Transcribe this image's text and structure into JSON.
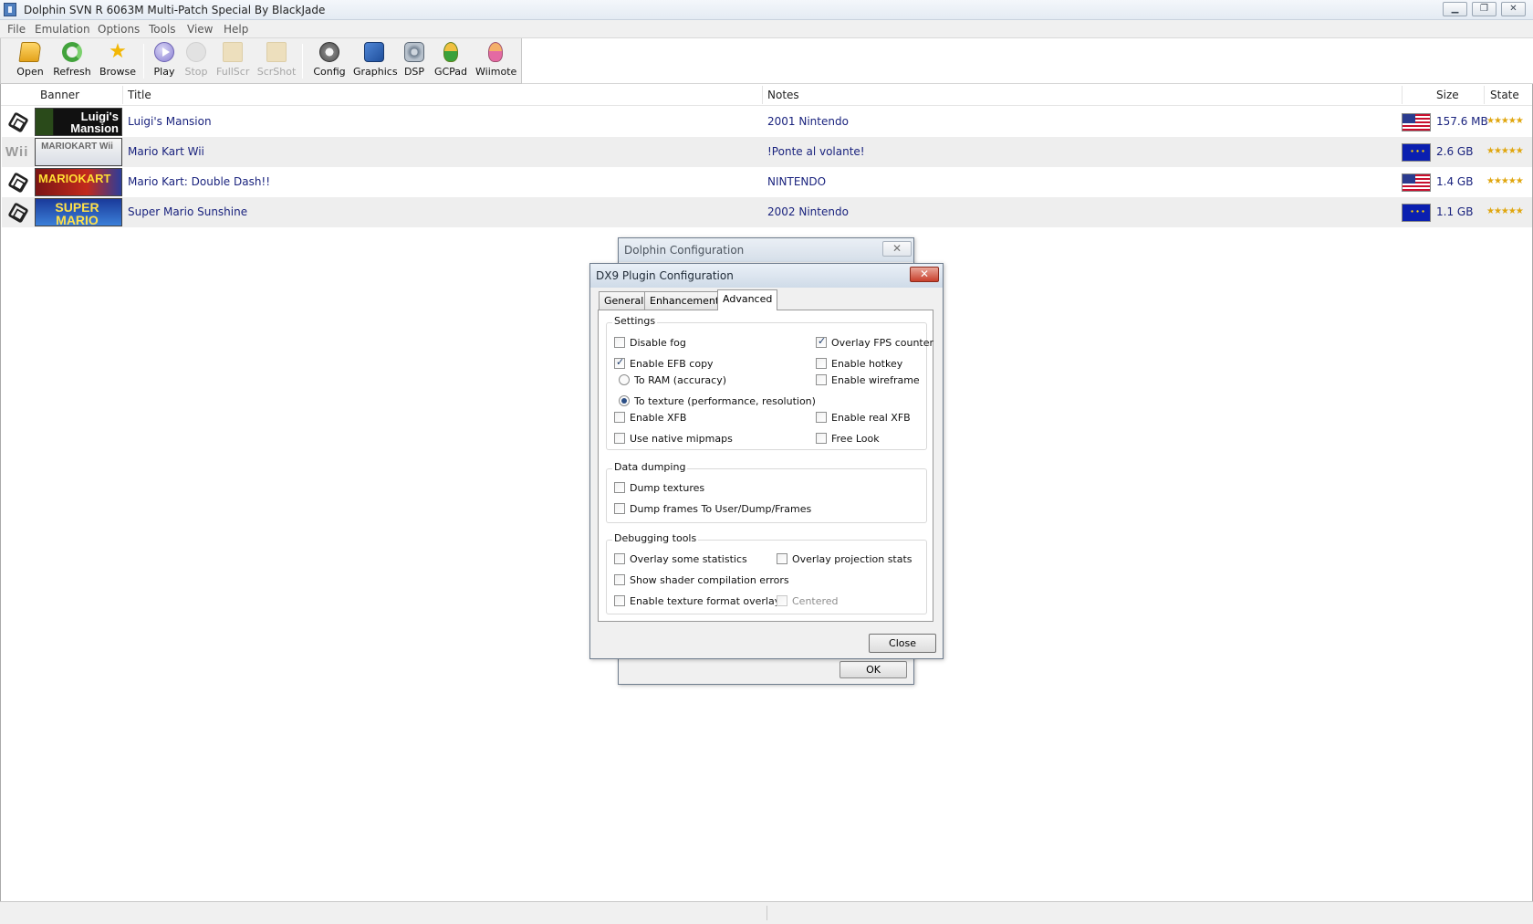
{
  "window": {
    "title": "Dolphin SVN R 6063M Multi-Patch Special By BlackJade",
    "minimize_icon": "minimize-icon",
    "maximize_icon": "restore-icon",
    "close_icon": "close-icon"
  },
  "menu": [
    "File",
    "Emulation",
    "Options",
    "Tools",
    "View",
    "Help"
  ],
  "toolbar": {
    "open": "Open",
    "refresh": "Refresh",
    "browse": "Browse",
    "play": "Play",
    "stop": "Stop",
    "fullscr": "FullScr",
    "scrshot": "ScrShot",
    "config": "Config",
    "graphics": "Graphics",
    "dsp": "DSP",
    "gcpad": "GCPad",
    "wiimote": "Wiimote",
    "disabled": [
      "Stop",
      "FullScr",
      "ScrShot"
    ]
  },
  "list": {
    "columns": {
      "banner": "Banner",
      "title": "Title",
      "notes": "Notes",
      "size": "Size",
      "state": "State"
    },
    "rows": [
      {
        "platform": "gamecube-icon",
        "banner": "Luigi's Mansion",
        "title": "Luigi's Mansion",
        "notes": "2001 Nintendo",
        "region": "usa-flag",
        "size": "157.6 MB",
        "state": "★★★★★"
      },
      {
        "platform": "Wii",
        "banner": "MARIOKART Wii",
        "title": "Mario Kart Wii",
        "notes": "!Ponte al volante!",
        "region": "eu-flag",
        "size": "2.6 GB",
        "state": "★★★★★"
      },
      {
        "platform": "gamecube-icon",
        "banner": "MARIOKART",
        "title": "Mario Kart: Double Dash!!",
        "notes": "NINTENDO",
        "region": "usa-flag",
        "size": "1.4 GB",
        "state": "★★★★★"
      },
      {
        "platform": "gamecube-icon",
        "banner": "SUPER MARIO SUNSHINE",
        "title": "Super Mario Sunshine",
        "notes": "2002  Nintendo",
        "region": "eu-flag",
        "size": "1.1 GB",
        "state": "★★★★★"
      }
    ]
  },
  "dolphin_config": {
    "title": "Dolphin Configuration",
    "ok": "OK"
  },
  "dx9_config": {
    "title": "DX9 Plugin Configuration",
    "tabs": [
      "General",
      "Enhancements",
      "Advanced"
    ],
    "active_tab": "Advanced",
    "settings": {
      "label": "Settings",
      "disable_fog": "Disable fog",
      "enable_efb_copy": "Enable EFB copy",
      "to_ram": "To RAM (accuracy)",
      "to_texture": "To texture (performance, resolution)",
      "enable_xfb": "Enable XFB",
      "native_mipmaps": "Use native mipmaps",
      "overlay_fps": "Overlay FPS counter",
      "enable_hotkey": "Enable hotkey",
      "enable_wireframe": "Enable wireframe",
      "enable_real_xfb": "Enable real XFB",
      "free_look": "Free Look"
    },
    "checked": [
      "Enable EFB copy",
      "Overlay FPS counter"
    ],
    "radio_selected": "To texture (performance, resolution)",
    "data_dumping": {
      "label": "Data dumping",
      "dump_textures": "Dump textures",
      "dump_frames": "Dump frames To User/Dump/Frames"
    },
    "debugging": {
      "label": "Debugging tools",
      "overlay_statistics": "Overlay some statistics",
      "overlay_projection": "Overlay projection stats",
      "shader_errors": "Show shader compilation errors",
      "texture_format_overlay": "Enable texture format overlay",
      "centered": "Centered"
    },
    "close": "Close"
  }
}
